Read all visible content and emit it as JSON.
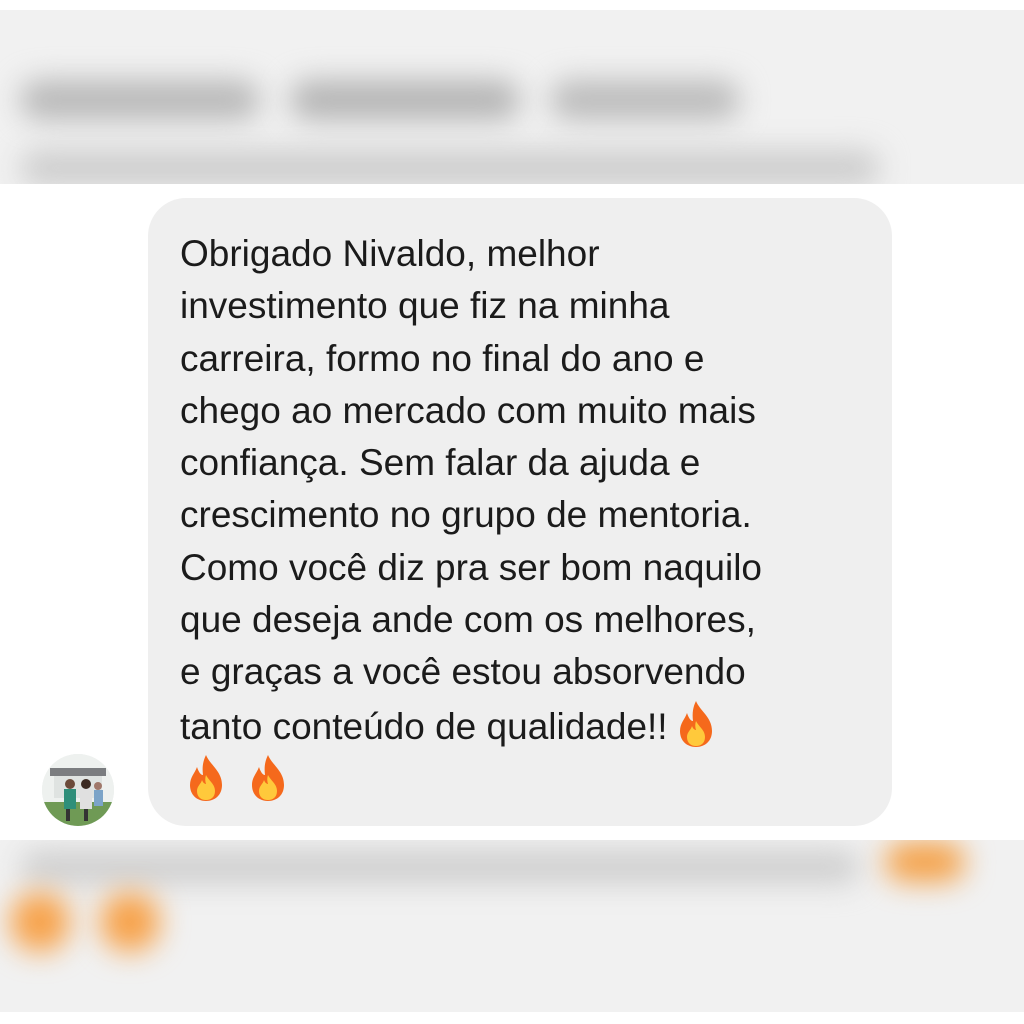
{
  "message": {
    "lines": [
      "Obrigado Nivaldo, melhor",
      "investimento que fiz na minha",
      "carreira, formo no final do ano e",
      "chego ao mercado com muito mais",
      "confiança. Sem falar da ajuda e",
      "crescimento no grupo de mentoria.",
      "Como você diz pra ser bom naquilo",
      "que deseja ande com os melhores,",
      "e graças a você estou absorvendo",
      "tanto conteúdo de qualidade!!"
    ],
    "trailing_emoji": "fire-icon",
    "final_row_emojis": [
      "fire-icon",
      "fire-icon"
    ]
  },
  "colors": {
    "bubble_background": "#efefef",
    "text": "#1b1b1b",
    "fire_outer": "#f5691c",
    "fire_inner": "#ffc93b"
  },
  "avatar": {
    "icon": "user-avatar-photo"
  }
}
